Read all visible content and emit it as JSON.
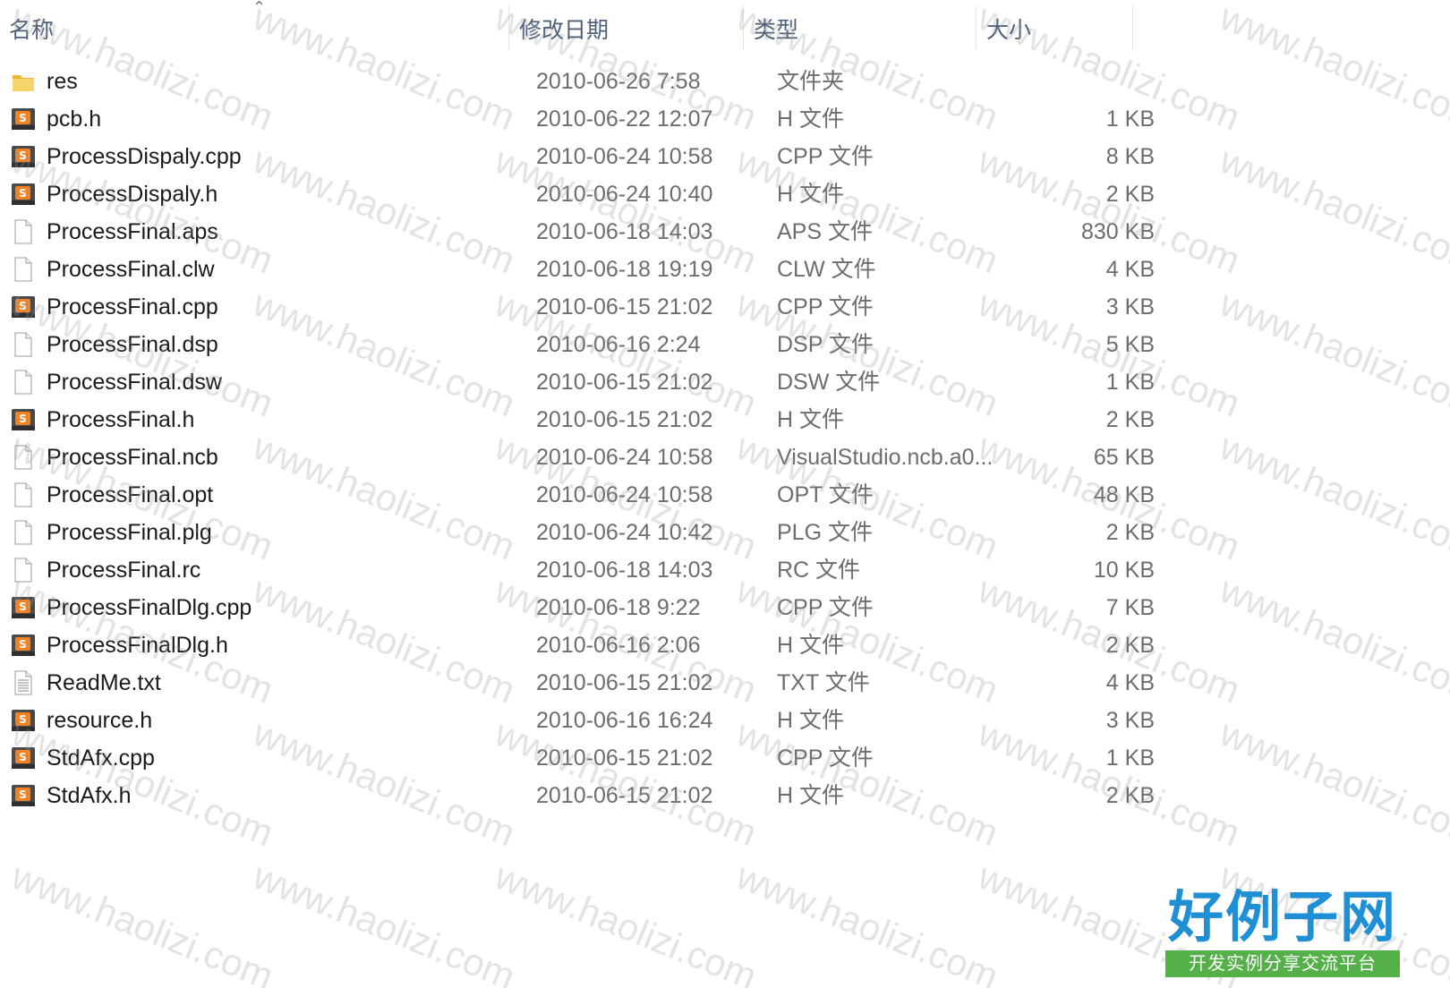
{
  "columns": {
    "name": "名称",
    "date": "修改日期",
    "type": "类型",
    "size": "大小"
  },
  "files": [
    {
      "name": "res",
      "date": "2010-06-26 7:58",
      "type": "文件夹",
      "size": "",
      "icon": "folder-icon"
    },
    {
      "name": "pcb.h",
      "date": "2010-06-22 12:07",
      "type": "H 文件",
      "size": "1 KB",
      "icon": "sublime-file-icon"
    },
    {
      "name": "ProcessDispaly.cpp",
      "date": "2010-06-24 10:58",
      "type": "CPP 文件",
      "size": "8 KB",
      "icon": "sublime-file-icon"
    },
    {
      "name": "ProcessDispaly.h",
      "date": "2010-06-24 10:40",
      "type": "H 文件",
      "size": "2 KB",
      "icon": "sublime-file-icon"
    },
    {
      "name": "ProcessFinal.aps",
      "date": "2010-06-18 14:03",
      "type": "APS 文件",
      "size": "830 KB",
      "icon": "blank-file-icon"
    },
    {
      "name": "ProcessFinal.clw",
      "date": "2010-06-18 19:19",
      "type": "CLW 文件",
      "size": "4 KB",
      "icon": "blank-file-icon"
    },
    {
      "name": "ProcessFinal.cpp",
      "date": "2010-06-15 21:02",
      "type": "CPP 文件",
      "size": "3 KB",
      "icon": "sublime-file-icon"
    },
    {
      "name": "ProcessFinal.dsp",
      "date": "2010-06-16 2:24",
      "type": "DSP 文件",
      "size": "5 KB",
      "icon": "blank-file-icon"
    },
    {
      "name": "ProcessFinal.dsw",
      "date": "2010-06-15 21:02",
      "type": "DSW 文件",
      "size": "1 KB",
      "icon": "blank-file-icon"
    },
    {
      "name": "ProcessFinal.h",
      "date": "2010-06-15 21:02",
      "type": "H 文件",
      "size": "2 KB",
      "icon": "sublime-file-icon"
    },
    {
      "name": "ProcessFinal.ncb",
      "date": "2010-06-24 10:58",
      "type": "VisualStudio.ncb.a0...",
      "size": "65 KB",
      "icon": "blank-file-icon"
    },
    {
      "name": "ProcessFinal.opt",
      "date": "2010-06-24 10:58",
      "type": "OPT 文件",
      "size": "48 KB",
      "icon": "blank-file-icon"
    },
    {
      "name": "ProcessFinal.plg",
      "date": "2010-06-24 10:42",
      "type": "PLG 文件",
      "size": "2 KB",
      "icon": "blank-file-icon"
    },
    {
      "name": "ProcessFinal.rc",
      "date": "2010-06-18 14:03",
      "type": "RC 文件",
      "size": "10 KB",
      "icon": "blank-file-icon"
    },
    {
      "name": "ProcessFinalDlg.cpp",
      "date": "2010-06-18 9:22",
      "type": "CPP 文件",
      "size": "7 KB",
      "icon": "sublime-file-icon"
    },
    {
      "name": "ProcessFinalDlg.h",
      "date": "2010-06-16 2:06",
      "type": "H 文件",
      "size": "2 KB",
      "icon": "sublime-file-icon"
    },
    {
      "name": "ReadMe.txt",
      "date": "2010-06-15 21:02",
      "type": "TXT 文件",
      "size": "4 KB",
      "icon": "text-file-icon"
    },
    {
      "name": "resource.h",
      "date": "2010-06-16 16:24",
      "type": "H 文件",
      "size": "3 KB",
      "icon": "sublime-file-icon"
    },
    {
      "name": "StdAfx.cpp",
      "date": "2010-06-15 21:02",
      "type": "CPP 文件",
      "size": "1 KB",
      "icon": "sublime-file-icon"
    },
    {
      "name": "StdAfx.h",
      "date": "2010-06-15 21:02",
      "type": "H 文件",
      "size": "2 KB",
      "icon": "sublime-file-icon"
    }
  ],
  "watermark": {
    "text": "www.haolizi.com",
    "color": "#9a9a9a"
  },
  "logo": {
    "title": "好例子网",
    "subtitle": "开发实例分享交流平台",
    "title_color": "#1f8fd6",
    "subtitle_bg": "#55b04a"
  },
  "colors": {
    "header_text": "#4c607a",
    "secondary_text": "#6d6d6d",
    "folder": "#f2c94c",
    "sublime_icon_bg": "#4a4a4a",
    "sublime_icon_accent": "#f58220"
  }
}
